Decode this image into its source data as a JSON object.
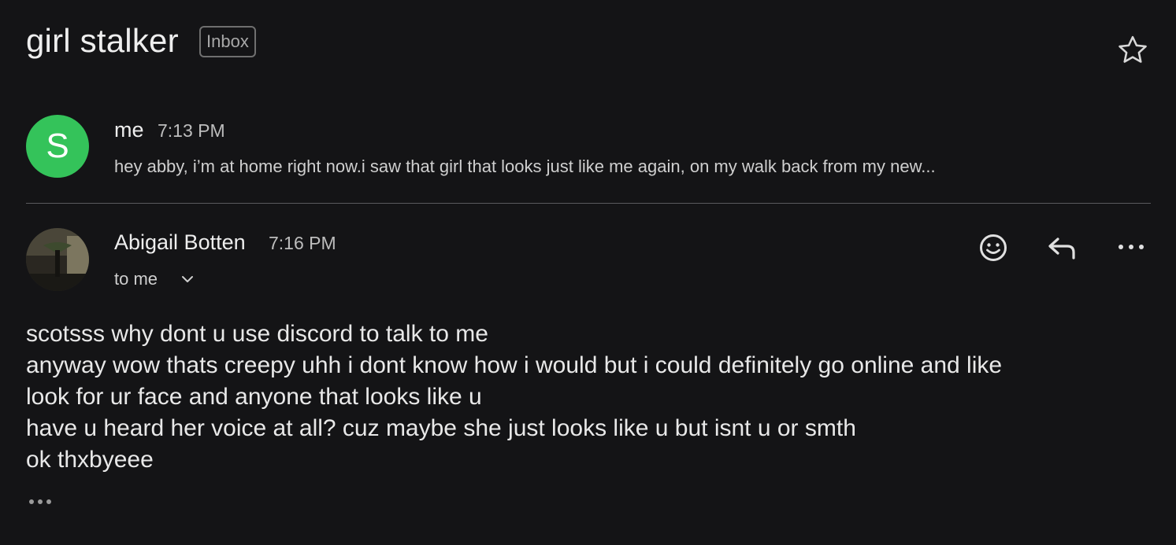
{
  "thread": {
    "subject": "girl stalker",
    "label_badge": "Inbox",
    "star_icon": "star-outline-icon"
  },
  "messages": [
    {
      "sender": "me",
      "time": "7:13 PM",
      "avatar_letter": "S",
      "avatar_color": "#34c35a",
      "snippet": "hey abby, i’m at home right now.i saw that girl that looks just like me again, on my walk back from my new..."
    },
    {
      "sender": "Abigail Botten",
      "time": "7:16 PM",
      "recipient_line": "to me",
      "actions": [
        "emoji-react-icon",
        "reply-icon",
        "more-options-icon"
      ],
      "body_lines": [
        "scotsss why dont u use discord to talk to me",
        "anyway wow thats creepy uhh i dont know how i would but i could definitely go online and like",
        "look for ur face and anyone that looks like u",
        "have u heard her voice at all? cuz maybe she just looks like u but isnt u or smth",
        "ok thxbyeee"
      ]
    }
  ],
  "colors": {
    "background": "#141416",
    "text_primary": "#eeeeee",
    "text_secondary": "#bdbdbd",
    "divider": "#5a5a5e"
  }
}
